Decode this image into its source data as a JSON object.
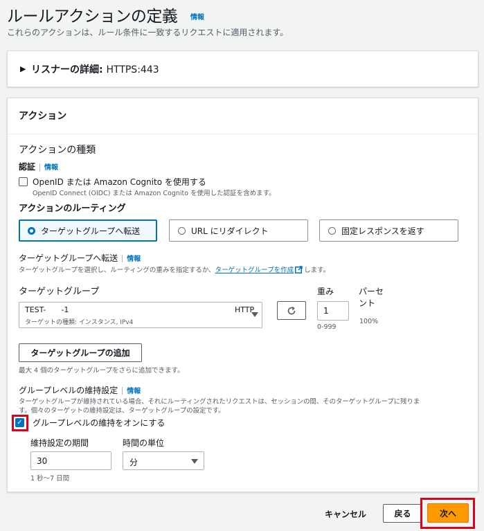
{
  "header": {
    "title": "ルールアクションの定義",
    "info": "情報",
    "subtitle": "これらのアクションは、ルール条件に一致するリクエストに適用されます。"
  },
  "listener": {
    "label": "リスナーの詳細:",
    "value": "HTTPS:443"
  },
  "actions": {
    "title": "アクション",
    "action_type_label": "アクションの種類",
    "auth": {
      "label": "認証",
      "info": "情報",
      "checkbox_label": "OpenID または Amazon Cognito を使用する",
      "checkbox_desc": "OpenID Connect (OIDC) または Amazon Cognito を使用した認証を含めます。",
      "checked": false
    },
    "routing": {
      "label": "アクションのルーティング",
      "options": [
        "ターゲットグループへ転送",
        "URL にリダイレクト",
        "固定レスポンスを返す"
      ],
      "selected": "ターゲットグループへ転送"
    },
    "forward": {
      "label": "ターゲットグループへ転送",
      "info": "情報",
      "desc_before": "ターゲットグループを選択し、ルーティングの重みを指定するか、",
      "desc_link": "ターゲットグループを作成",
      "desc_after": "します。",
      "tg_label": "ターゲットグループ",
      "tg_name_prefix": "TEST-",
      "tg_name_suffix": "-1",
      "tg_protocol": "HTTP",
      "tg_detail": "ターゲットの種類: インスタンス, IPv4",
      "weight_label": "重み",
      "weight_value": "1",
      "weight_range": "0-999",
      "percent_label_1": "パーセ",
      "percent_label_2": "ント",
      "percent_value": "100%",
      "add_button": "ターゲットグループの追加",
      "add_desc": "最大 4 個のターゲットグループをさらに追加できます。"
    },
    "stickiness": {
      "label": "グループレベルの維持設定",
      "info": "情報",
      "desc_1": "ターゲットグループが維持されている場合、それにルーティングされたリクエストは、セッションの間、そのターゲットグループに残りま",
      "desc_2": "す。個々のターゲットの維持設定は、ターゲットグループの設定です。",
      "checkbox_label": "グループレベルの維持をオンにする",
      "checked": true,
      "duration_label": "維持設定の期間",
      "duration_value": "30",
      "duration_hint": "1 秒〜7 日間",
      "unit_label": "時間の単位",
      "unit_value": "分"
    }
  },
  "footer": {
    "cancel": "キャンセル",
    "back": "戻る",
    "next": "次へ"
  },
  "icons": {
    "refresh": "refresh-icon",
    "external": "external-link-icon",
    "check": "check-icon",
    "caret": "caret-down-icon"
  },
  "colors": {
    "accent": "#0073bb",
    "primary_button": "#ff9900",
    "highlight": "#e0001b"
  }
}
